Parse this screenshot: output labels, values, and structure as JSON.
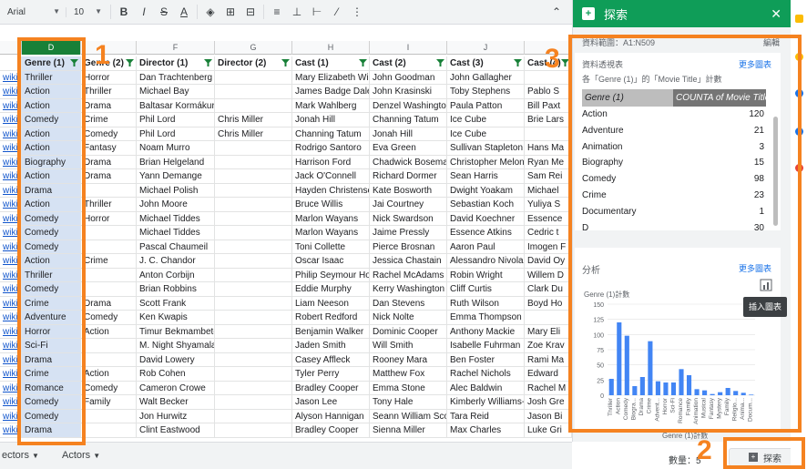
{
  "toolbar": {
    "font_name": "Arial",
    "font_size": "10",
    "buttons": [
      "B",
      "I",
      "S",
      "A",
      "fill",
      "borders",
      "merge",
      "align",
      "valign",
      "wrap",
      "rotate",
      "more"
    ]
  },
  "columns": {
    "headers": [
      "",
      "D",
      "",
      "F",
      "G",
      "H",
      "I",
      "J",
      ""
    ],
    "row1": [
      "",
      "Genre (1)",
      "Genre (2)",
      "Director (1)",
      "Director (2)",
      "Cast (1)",
      "Cast (2)",
      "Cast (3)",
      "Cast (4)"
    ]
  },
  "rows": [
    [
      "wiki",
      "Thriller",
      "Horror",
      "Dan Trachtenberg",
      "",
      "Mary Elizabeth Wir",
      "John Goodman",
      "John Gallagher",
      ""
    ],
    [
      "wiki",
      "Action",
      "Thriller",
      "Michael Bay",
      "",
      "James Badge Dale",
      "John Krasinski",
      "Toby Stephens",
      "Pablo S"
    ],
    [
      "wiki",
      "Action",
      "Drama",
      "Baltasar Kormákur",
      "",
      "Mark Wahlberg",
      "Denzel Washingtor",
      "Paula Patton",
      "Bill Paxt"
    ],
    [
      "wiki",
      "Comedy",
      "Crime",
      "Phil Lord",
      "Chris Miller",
      "Jonah Hill",
      "Channing Tatum",
      "Ice Cube",
      "Brie Lars"
    ],
    [
      "wiki",
      "Action",
      "Comedy",
      "Phil Lord",
      "Chris Miller",
      "Channing Tatum",
      "Jonah Hill",
      "Ice Cube",
      ""
    ],
    [
      "wiki",
      "Action",
      "Fantasy",
      "Noam Murro",
      "",
      "Rodrigo Santoro",
      "Eva Green",
      "Sullivan Stapleton",
      "Hans Ma"
    ],
    [
      "wiki",
      "Biography",
      "Drama",
      "Brian Helgeland",
      "",
      "Harrison Ford",
      "Chadwick Bosema",
      "Christopher Melon",
      "Ryan Me"
    ],
    [
      "wiki",
      "Action",
      "Drama",
      "Yann Demange",
      "",
      "Jack O'Connell",
      "Richard Dormer",
      "Sean Harris",
      "Sam Rei"
    ],
    [
      "wiki",
      "Drama",
      "",
      "Michael Polish",
      "",
      "Hayden Christense",
      "Kate Bosworth",
      "Dwight Yoakam",
      "Michael"
    ],
    [
      "wiki",
      "Action",
      "Thriller",
      "John Moore",
      "",
      "Bruce Willis",
      "Jai Courtney",
      "Sebastian Koch",
      "Yuliya S"
    ],
    [
      "wiki",
      "Comedy",
      "Horror",
      "Michael Tiddes",
      "",
      "Marlon Wayans",
      "Nick Swardson",
      "David Koechner",
      "Essence"
    ],
    [
      "wiki",
      "Comedy",
      "",
      "Michael Tiddes",
      "",
      "Marlon Wayans",
      "Jaime Pressly",
      "Essence Atkins",
      "Cedric t"
    ],
    [
      "wiki",
      "Comedy",
      "",
      "Pascal Chaumeil",
      "",
      "Toni Collette",
      "Pierce Brosnan",
      "Aaron Paul",
      "Imogen F"
    ],
    [
      "wiki",
      "Action",
      "Crime",
      "J. C. Chandor",
      "",
      "Oscar Isaac",
      "Jessica Chastain",
      "Alessandro Nivola",
      "David Oy"
    ],
    [
      "wiki",
      "Thriller",
      "",
      "Anton Corbijn",
      "",
      "Philip Seymour Ho",
      "Rachel McAdams",
      "Robin Wright",
      "Willem D"
    ],
    [
      "wiki",
      "Comedy",
      "",
      "Brian Robbins",
      "",
      "Eddie Murphy",
      "Kerry Washington",
      "Cliff Curtis",
      "Clark Du"
    ],
    [
      "wiki",
      "Crime",
      "Drama",
      "Scott Frank",
      "",
      "Liam Neeson",
      "Dan Stevens",
      "Ruth Wilson",
      "Boyd Ho"
    ],
    [
      "wiki",
      "Adventure",
      "Comedy",
      "Ken Kwapis",
      "",
      "Robert Redford",
      "Nick Nolte",
      "Emma Thompson",
      ""
    ],
    [
      "wiki",
      "Horror",
      "Action",
      "Timur Bekmambetov",
      "",
      "Benjamin Walker",
      "Dominic Cooper",
      "Anthony Mackie",
      "Mary Eli"
    ],
    [
      "wiki",
      "Sci-Fi",
      "",
      "M. Night Shyamalan",
      "",
      "Jaden Smith",
      "Will Smith",
      "Isabelle Fuhrman",
      "Zoe Krav"
    ],
    [
      "wiki",
      "Drama",
      "",
      "David Lowery",
      "",
      "Casey Affleck",
      "Rooney Mara",
      "Ben Foster",
      "Rami Ma"
    ],
    [
      "wiki",
      "Crime",
      "Action",
      "Rob Cohen",
      "",
      "Tyler Perry",
      "Matthew Fox",
      "Rachel Nichols",
      "Edward"
    ],
    [
      "wiki",
      "Romance",
      "Comedy",
      "Cameron Crowe",
      "",
      "Bradley Cooper",
      "Emma Stone",
      "Alec Baldwin",
      "Rachel M"
    ],
    [
      "wiki",
      "Comedy",
      "Family",
      "Walt Becker",
      "",
      "Jason Lee",
      "Tony Hale",
      "Kimberly Williams-",
      "Josh Gre"
    ],
    [
      "wiki",
      "Comedy",
      "",
      "Jon Hurwitz",
      "",
      "Alyson Hannigan",
      "Seann William Sco",
      "Tara Reid",
      "Jason Bi"
    ],
    [
      "wiki",
      "Drama",
      "",
      "Clint Eastwood",
      "",
      "Bradley Cooper",
      "Sienna Miller",
      "Max Charles",
      "Luke Gri"
    ]
  ],
  "tabs": [
    "ectors",
    "Actors"
  ],
  "status": {
    "count": "數量：5",
    "explore_label": "探索"
  },
  "panel": {
    "title": "探索",
    "range": "資料範圍：A1:N509",
    "edit": "編輯",
    "pivot": {
      "title": "資料透視表",
      "more": "更多圖表",
      "subtitle": "各「Genre (1)」的「Movie Title」計數",
      "col1": "Genre (1)",
      "col2": "COUNTA of Movie Title",
      "rows": [
        [
          "Action",
          "120"
        ],
        [
          "Adventure",
          "21"
        ],
        [
          "Animation",
          "3"
        ],
        [
          "Biography",
          "15"
        ],
        [
          "Comedy",
          "98"
        ],
        [
          "Crime",
          "23"
        ],
        [
          "Documentary",
          "1"
        ],
        [
          "D",
          "30"
        ]
      ]
    },
    "analysis": {
      "title": "分析",
      "more": "更多圖表",
      "insert_tip": "插入圖表",
      "footer": "Genre (1)計數"
    }
  },
  "chart_data": {
    "type": "bar",
    "title": "Genre (1)計數",
    "categories": [
      "Thriller",
      "Action",
      "Comedy",
      "Biogra...",
      "Drama",
      "Crime",
      "Advent...",
      "Horror",
      "Sci-Fi",
      "Romance",
      "Family",
      "Animation",
      "Musical",
      "Fantasy",
      "Mystery",
      "Family",
      "Religio...",
      "Anima...",
      "Docum..."
    ],
    "values": [
      27,
      120,
      98,
      15,
      30,
      89,
      23,
      21,
      21,
      43,
      33,
      10,
      8,
      2,
      5,
      12,
      7,
      4,
      1
    ],
    "ylim": [
      0,
      150
    ],
    "yticks": [
      0,
      25,
      50,
      75,
      100,
      125,
      150
    ],
    "color": "#4285f4"
  },
  "annotations": [
    "1",
    "2",
    "3"
  ]
}
